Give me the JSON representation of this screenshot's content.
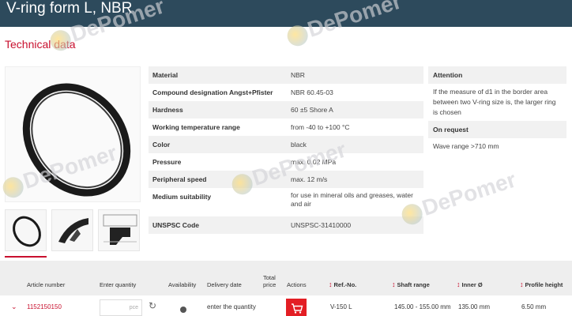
{
  "header": {
    "title": "V-ring form L, NBR"
  },
  "section_title": "Technical data",
  "specs": [
    {
      "label": "Material",
      "value": "NBR"
    },
    {
      "label": "Compound designation Angst+Pfister",
      "value": "NBR 60.45-03"
    },
    {
      "label": "Hardness",
      "value": "60 ±5 Shore A"
    },
    {
      "label": "Working temperature range",
      "value": "from -40 to +100 °C"
    },
    {
      "label": "Color",
      "value": "black"
    },
    {
      "label": "Pressure",
      "value": "max. 0.02 MPa"
    },
    {
      "label": "Peripheral speed",
      "value": "max. 12 m/s"
    },
    {
      "label": "Medium suitability",
      "value": "for use in mineral oils and greases, water and air"
    },
    {
      "label": "UNSPSC Code",
      "value": "UNSPSC-31410000"
    }
  ],
  "attention": {
    "title": "Attention",
    "text": "If the measure of d1 in the border area between two V-ring size is, the larger ring is chosen"
  },
  "on_request": {
    "title": "On request",
    "text": "Wave range >710 mm"
  },
  "table": {
    "headers": {
      "article": "Article number",
      "quantity": "Enter quantity",
      "availability": "Availability",
      "delivery": "Delivery date",
      "total_line1": "Total",
      "total_line2": "price",
      "actions": "Actions",
      "ref": "Ref.-No.",
      "shaft": "Shaft range",
      "inner": "Inner Ø",
      "profile": "Profile height"
    },
    "row": {
      "article": "1152150150",
      "qty_unit": "pce",
      "delivery": "enter the quantity",
      "ref": "V-150 L",
      "shaft": "145.00 - 155.00 mm",
      "inner": "135.00 mm",
      "profile": "6.50 mm"
    }
  },
  "watermark": {
    "text": "DePomer"
  },
  "colors": {
    "header_bg": "#2d4a5c",
    "accent": "#c8102e",
    "cart_button": "#e31e24"
  }
}
